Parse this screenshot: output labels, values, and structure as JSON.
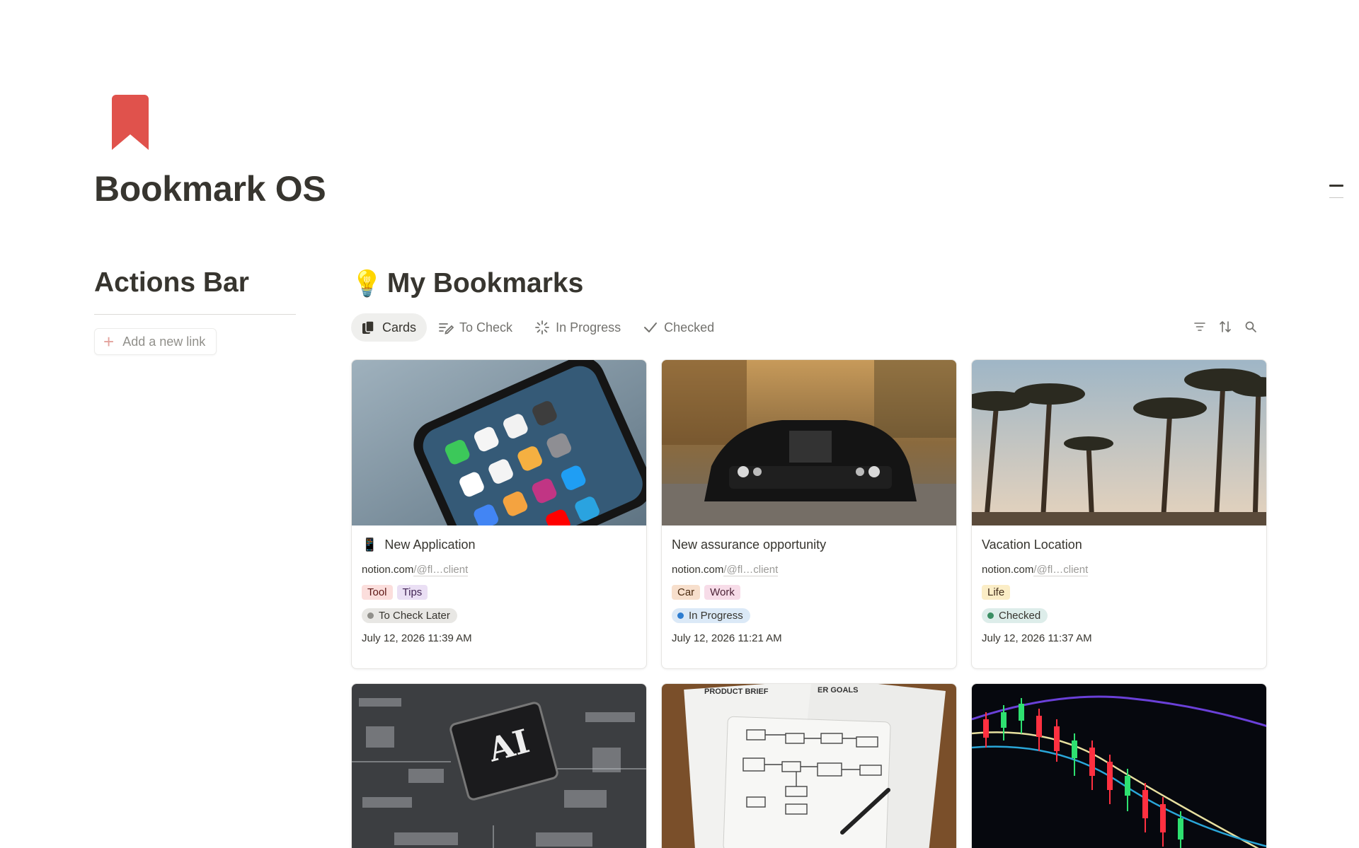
{
  "page": {
    "title": "Bookmark OS",
    "icon": "bookmark-icon",
    "icon_color": "#e0524c"
  },
  "sidebar": {
    "title": "Actions Bar",
    "add_link_label": "Add a new link"
  },
  "main": {
    "section_emoji": "💡",
    "section_title": "My Bookmarks",
    "tabs": [
      {
        "label": "Cards",
        "icon": "cards-icon",
        "active": true
      },
      {
        "label": "To Check",
        "icon": "to-check-icon",
        "active": false
      },
      {
        "label": "In Progress",
        "icon": "in-progress-icon",
        "active": false
      },
      {
        "label": "Checked",
        "icon": "checkmark-icon",
        "active": false
      }
    ],
    "tools": [
      "filter-icon",
      "sort-icon",
      "search-icon"
    ]
  },
  "cards": [
    {
      "emoji": "📱",
      "title": "New Application",
      "domain": "notion.com",
      "path": "/@fl…client",
      "cover": "smartphone-apps-photo",
      "tags": [
        {
          "label": "Tool",
          "bg": "#fbdedc",
          "color": "#5d1715"
        },
        {
          "label": "Tips",
          "bg": "#eadff4",
          "color": "#412454"
        }
      ],
      "status": {
        "label": "To Check Later",
        "dot": "#91908b",
        "bg": "#e8e7e4"
      },
      "date": "July 12, 2026 11:39 AM"
    },
    {
      "emoji": "",
      "title": "New assurance opportunity",
      "domain": "notion.com",
      "path": "/@fl…client",
      "cover": "black-muscle-car-photo",
      "tags": [
        {
          "label": "Car",
          "bg": "#f7dfcc",
          "color": "#49290e"
        },
        {
          "label": "Work",
          "bg": "#f7dce8",
          "color": "#4c2337"
        }
      ],
      "status": {
        "label": "In Progress",
        "dot": "#2e7dd1",
        "bg": "#dbe9f7"
      },
      "date": "July 12, 2026 11:21 AM"
    },
    {
      "emoji": "",
      "title": "Vacation Location",
      "domain": "notion.com",
      "path": "/@fl…client",
      "cover": "palm-trees-photo",
      "tags": [
        {
          "label": "Life",
          "bg": "#fbedc6",
          "color": "#402c1b"
        }
      ],
      "status": {
        "label": "Checked",
        "dot": "#3b8f64",
        "bg": "#ddedea"
      },
      "date": "July 12, 2026 11:37 AM"
    },
    {
      "cover": "ai-chip-circuit-photo",
      "chip_text": "AI"
    },
    {
      "cover": "product-brief-sketch-photo",
      "doc_text_1": "PRODUCT BRIEF",
      "doc_text_2": "ER GOALS"
    },
    {
      "cover": "stock-candlestick-chart-photo"
    }
  ]
}
